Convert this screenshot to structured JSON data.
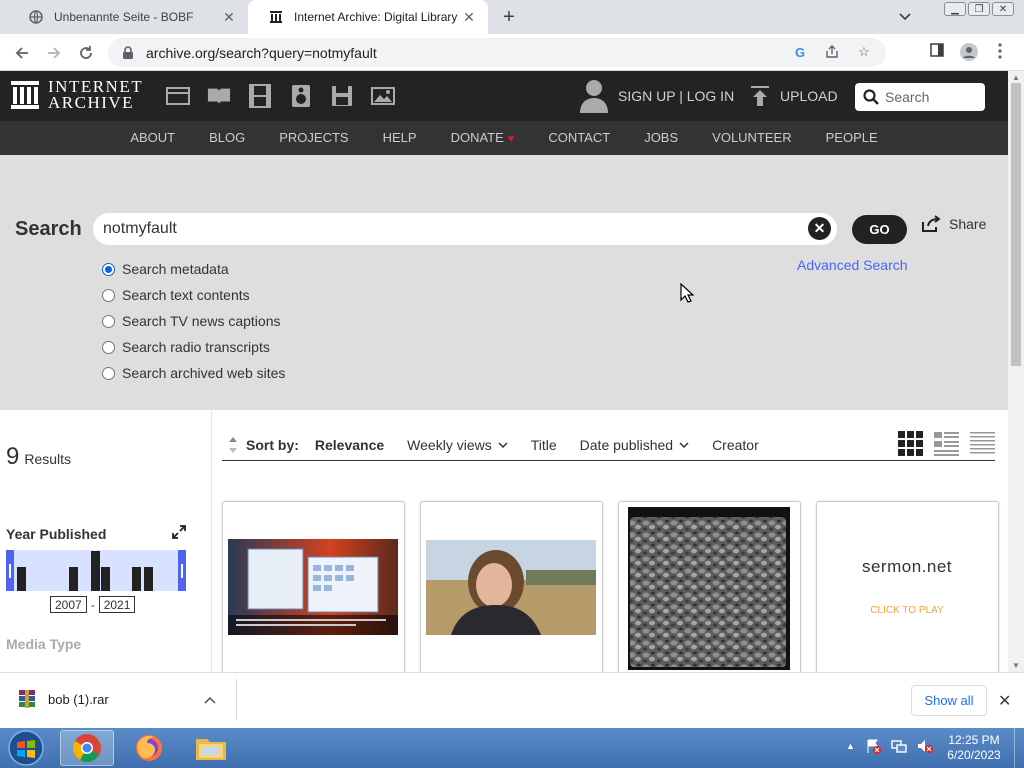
{
  "browser": {
    "tabs": [
      {
        "title": "Unbenannte Seite - BOBF",
        "active": false
      },
      {
        "title": "Internet Archive: Digital Library of",
        "active": true
      }
    ],
    "url": "archive.org/search?query=notmyfault"
  },
  "ia_header": {
    "logo_line1": "INTERNET",
    "logo_line2": "ARCHIVE",
    "media_icons": [
      "web-icon",
      "texts-icon",
      "video-icon",
      "audio-icon",
      "software-icon",
      "images-icon"
    ],
    "signup_label": "SIGN UP | LOG IN",
    "upload_label": "UPLOAD",
    "search_placeholder": "Search"
  },
  "nav": {
    "items": [
      "ABOUT",
      "BLOG",
      "PROJECTS",
      "HELP",
      "DONATE",
      "CONTACT",
      "JOBS",
      "VOLUNTEER",
      "PEOPLE"
    ]
  },
  "search": {
    "label": "Search",
    "query": "notmyfault",
    "go_label": "GO",
    "share_label": "Share",
    "advanced_label": "Advanced Search",
    "options": [
      {
        "label": "Search metadata",
        "checked": true
      },
      {
        "label": "Search text contents",
        "checked": false
      },
      {
        "label": "Search TV news captions",
        "checked": false
      },
      {
        "label": "Search radio transcripts",
        "checked": false
      },
      {
        "label": "Search archived web sites",
        "checked": false
      }
    ]
  },
  "results": {
    "count": "9",
    "count_label": "Results",
    "year_published_label": "Year Published",
    "year_from": "2007",
    "year_to": "2021",
    "media_type_label": "Media Type",
    "sort": {
      "label": "Sort by:",
      "options": [
        "Relevance",
        "Weekly views",
        "Title",
        "Date published",
        "Creator"
      ],
      "active": "Relevance"
    },
    "tiles": [
      {
        "thumb": "windows-screenshot-thumbnail"
      },
      {
        "thumb": "girl-in-field-thumbnail"
      },
      {
        "thumb": "gravel-photo-thumbnail"
      },
      {
        "thumb": "sermon-net-thumbnail",
        "text_main": "sermon.net",
        "text_sub": "CLICK TO PLAY"
      }
    ]
  },
  "downloads": {
    "file_name": "bob (1).rar",
    "show_all_label": "Show all"
  },
  "taskbar": {
    "time": "12:25 PM",
    "date": "6/20/2023"
  },
  "colors": {
    "ia_dark": "#232323",
    "ia_nav": "#333333",
    "search_bg": "#dedede",
    "link_blue": "#4b64ff",
    "histogram_blue": "#4f65f2",
    "donate_heart": "#e0162b"
  }
}
